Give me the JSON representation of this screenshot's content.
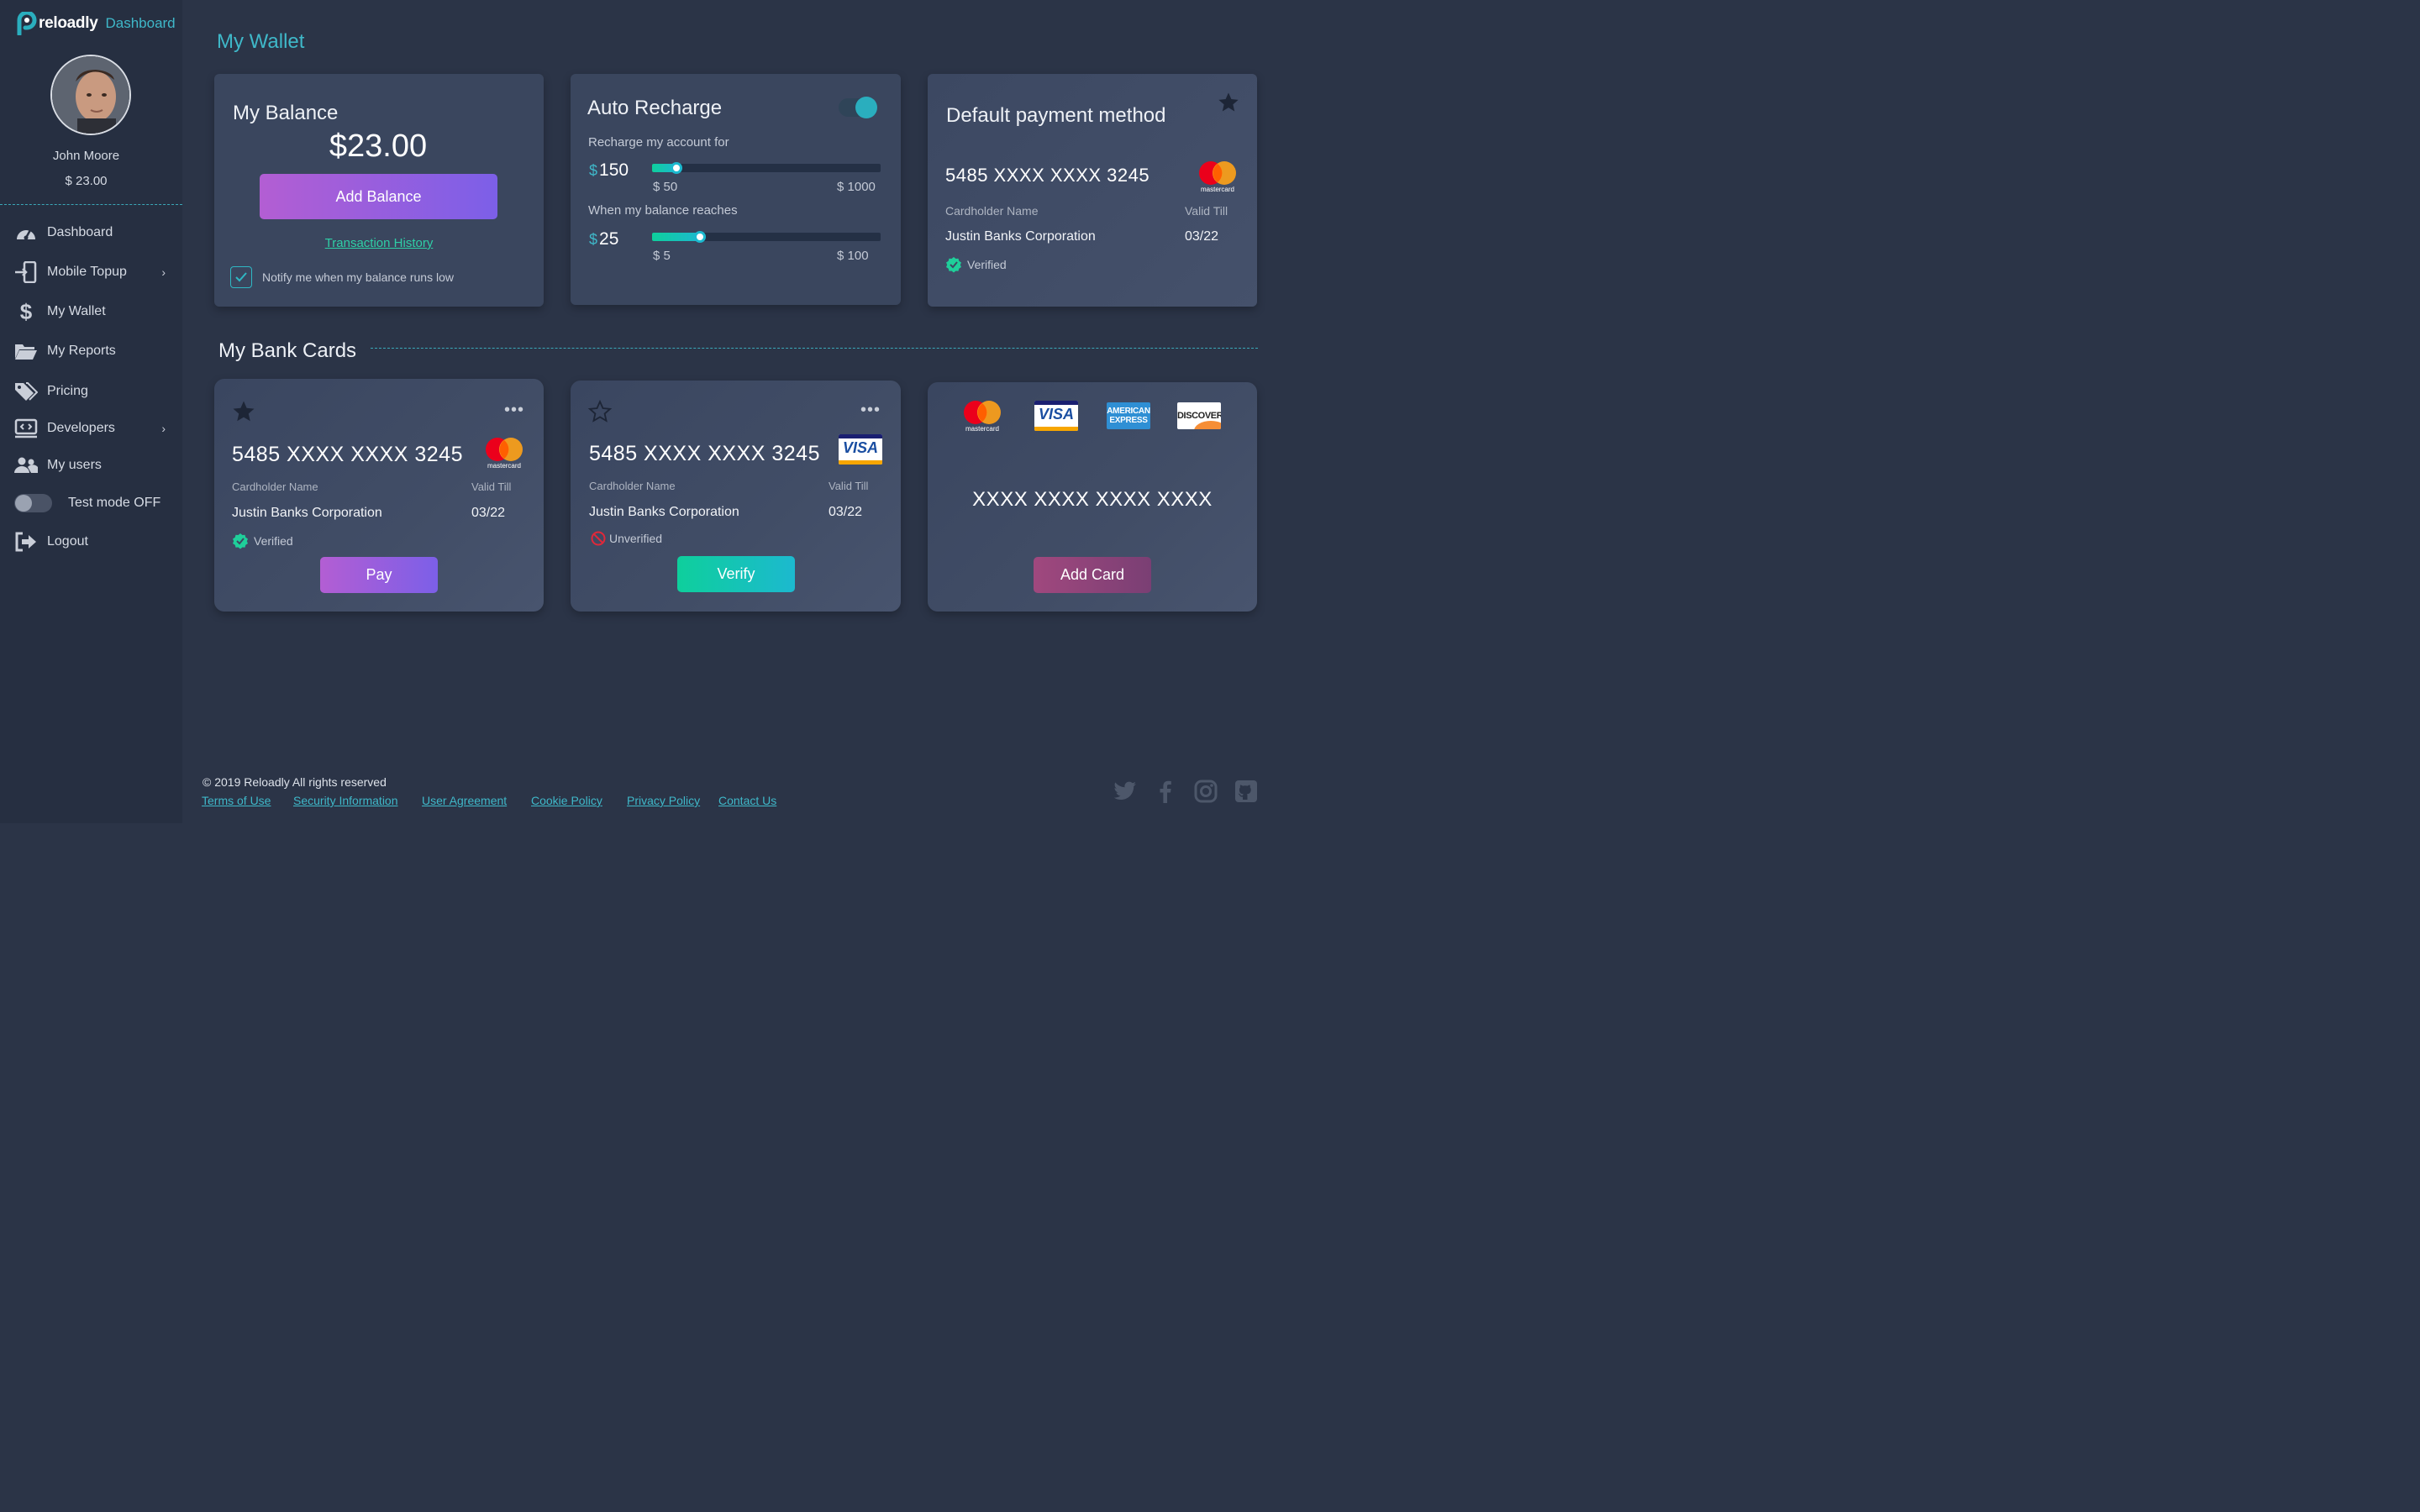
{
  "brand": {
    "name": "reloadly",
    "section": "Dashboard"
  },
  "profile": {
    "name": "John Moore",
    "balance": "$ 23.00"
  },
  "nav": {
    "items": [
      {
        "label": "Dashboard",
        "icon": "speedometer-icon"
      },
      {
        "label": "Mobile Topup",
        "icon": "phone-topup-icon",
        "chevron": "›"
      },
      {
        "label": "My Wallet",
        "icon": "dollar-icon"
      },
      {
        "label": "My Reports",
        "icon": "folder-icon"
      },
      {
        "label": "Pricing",
        "icon": "tag-icon"
      },
      {
        "label": "Developers",
        "icon": "code-monitor-icon",
        "chevron": "›"
      },
      {
        "label": "My users",
        "icon": "users-icon"
      },
      {
        "label": "Test mode OFF",
        "icon": "toggle-icon"
      },
      {
        "label": "Logout",
        "icon": "logout-icon"
      }
    ]
  },
  "page": {
    "title": "My Wallet"
  },
  "balance_card": {
    "title": "My Balance",
    "amount": "$23.00",
    "add_button": "Add Balance",
    "history_link": "Transaction History",
    "notify_label": "Notify me when my balance runs low",
    "notify_checked": true
  },
  "auto_recharge": {
    "title": "Auto Recharge",
    "enabled": true,
    "recharge_label": "Recharge my account for",
    "recharge_currency": "$",
    "recharge_value": "150",
    "recharge_min": "$ 50",
    "recharge_max": "$ 1000",
    "recharge_fraction": 0.105,
    "threshold_label": "When my balance reaches",
    "threshold_currency": "$",
    "threshold_value": "25",
    "threshold_min": "$ 5",
    "threshold_max": "$ 100",
    "threshold_fraction": 0.21
  },
  "default_payment": {
    "title": "Default payment method",
    "card_number": "5485 XXXX XXXX 3245",
    "brand": "mastercard",
    "cardholder_label": "Cardholder Name",
    "valid_label": "Valid Till",
    "cardholder": "Justin Banks Corporation",
    "valid_till": "03/22",
    "status": "Verified"
  },
  "bank_cards": {
    "title": "My Bank Cards",
    "cards": [
      {
        "card_number": "5485 XXXX XXXX 3245",
        "brand": "mastercard",
        "cardholder_label": "Cardholder Name",
        "valid_label": "Valid Till",
        "cardholder": "Justin Banks Corporation",
        "valid_till": "03/22",
        "status": "Verified",
        "starred": true,
        "menu": "•••",
        "action": "Pay"
      },
      {
        "card_number": "5485 XXXX XXXX 3245",
        "brand": "visa",
        "cardholder_label": "Cardholder Name",
        "valid_label": "Valid Till",
        "cardholder": "Justin Banks Corporation",
        "valid_till": "03/22",
        "status": "Unverified",
        "starred": false,
        "menu": "•••",
        "action": "Verify"
      }
    ],
    "add_card": {
      "placeholder_number": "XXXX XXXX XXXX XXXX",
      "action": "Add Card",
      "brands": [
        "mastercard",
        "visa",
        "american-express",
        "discover"
      ]
    }
  },
  "logos": {
    "mastercard": "mastercard",
    "visa": "VISA",
    "amex_line1": "AMERICAN",
    "amex_line2": "EXPRESS",
    "discover": "DISCOVER"
  },
  "footer": {
    "copyright": "© 2019 Reloadly All rights reserved",
    "links": [
      "Terms of Use",
      "Security Information",
      "User Agreement",
      "Cookie Policy",
      "Privacy Policy",
      "Contact Us"
    ],
    "social": [
      "twitter-icon",
      "facebook-icon",
      "instagram-icon",
      "github-icon"
    ]
  },
  "colors": {
    "background": "#2b3447",
    "sidebar": "#262f41",
    "card": "#3a465e",
    "accent_teal": "#3fb8c9",
    "green": "#2fcfa6",
    "purple_start": "#b35ed3",
    "purple_end": "#7c5fe8"
  }
}
